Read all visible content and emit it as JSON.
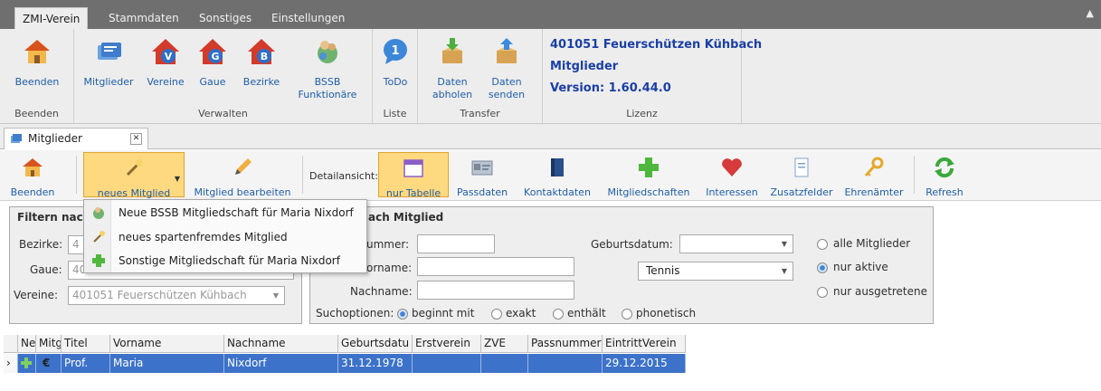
{
  "top_tabs": [
    "ZMI-Verein",
    "Stammdaten",
    "Sonstiges",
    "Einstellungen"
  ],
  "ribbon": {
    "groups": {
      "beenden": "Beenden",
      "verwalten": "Verwalten",
      "liste": "Liste",
      "transfer": "Transfer",
      "lizenz": "Lizenz"
    },
    "buttons": {
      "beenden": "Beenden",
      "mitglieder": "Mitglieder",
      "vereine": "Vereine",
      "gaue": "Gaue",
      "bezirke": "Bezirke",
      "bssb1": "BSSB",
      "bssb2": "Funktionäre",
      "todo": "ToDo",
      "abholen1": "Daten",
      "abholen2": "abholen",
      "senden1": "Daten",
      "senden2": "senden"
    },
    "license": {
      "line1": "401051 Feuerschützen Kühbach",
      "line2": "Mitglieder",
      "line3": "Version: 1.60.44.0"
    }
  },
  "doc_tab": "Mitglieder",
  "toolbar": {
    "beenden": "Beenden",
    "neues_mitglied": "neues Mitglied",
    "mitglied_bearbeiten": "Mitglied bearbeiten",
    "detailansicht": "Detailansicht:",
    "nur_tabelle": "nur Tabelle",
    "passdaten": "Passdaten",
    "kontaktdaten": "Kontaktdaten",
    "mitgliedschaften": "Mitgliedschaften",
    "interessen": "Interessen",
    "zusatzfelder": "Zusatzfelder",
    "ehrenaemter": "Ehrenämter",
    "refresh": "Refresh"
  },
  "menu": [
    "Neue BSSB Mitgliedschaft für Maria Nixdorf",
    "neues spartenfremdes Mitglied",
    "Sonstige Mitgliedschaft für Maria Nixdorf"
  ],
  "filter_left": {
    "title": "Filtern nac",
    "bezirke_label": "Bezirke:",
    "bezirke_value": "4",
    "gaue_label": "Gaue:",
    "gaue_value": "40",
    "vereine_label": "Vereine:",
    "vereine_value": "401051  Feuerschützen Kühbach"
  },
  "filter_right": {
    "title": "ach Mitglied",
    "nummer_label": "ummer:",
    "vorname_label": "orname:",
    "nachname_label": "Nachname:",
    "geburtsdatum_label": "Geburtsdatum:",
    "sparte_value": "Tennis",
    "suchoptionen_label": "Suchoptionen:",
    "suchoptionen": [
      "beginnt mit",
      "exakt",
      "enthält",
      "phonetisch"
    ],
    "status_options": [
      "alle Mitglieder",
      "nur aktive",
      "nur ausgetretene"
    ]
  },
  "grid": {
    "headers": [
      "Neu",
      "Mitg",
      "Titel",
      "Vorname",
      "Nachname",
      "Geburtsdatu",
      "Erstverein",
      "ZVE",
      "Passnummer",
      "EintrittVerein"
    ],
    "row": {
      "titel": "Prof.",
      "vorname": "Maria",
      "nachname": "Nixdorf",
      "geburtsdatum": "31.12.1978",
      "eintritt": "29.12.2015"
    }
  },
  "colors": {
    "accent": "#3c72c9",
    "link_blue": "#1f5ea8",
    "license_blue": "#1a3fa6",
    "highlight": "#ffd980"
  }
}
